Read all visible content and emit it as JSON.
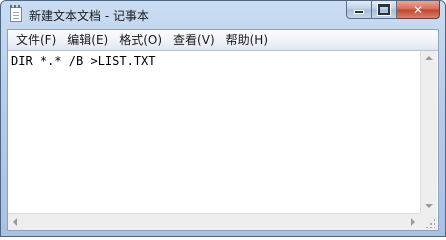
{
  "window": {
    "title": "新建文本文档 - 记事本",
    "close_glyph": "✕"
  },
  "menu": {
    "items": [
      {
        "label": "文件(F)"
      },
      {
        "label": "编辑(E)"
      },
      {
        "label": "格式(O)"
      },
      {
        "label": "查看(V)"
      },
      {
        "label": "帮助(H)"
      }
    ]
  },
  "editor": {
    "content": "DIR *.* /B >LIST.TXT"
  },
  "icons": {
    "app": "notepad-icon",
    "minimize": "minimize-icon",
    "maximize": "maximize-icon",
    "close": "close-icon"
  }
}
